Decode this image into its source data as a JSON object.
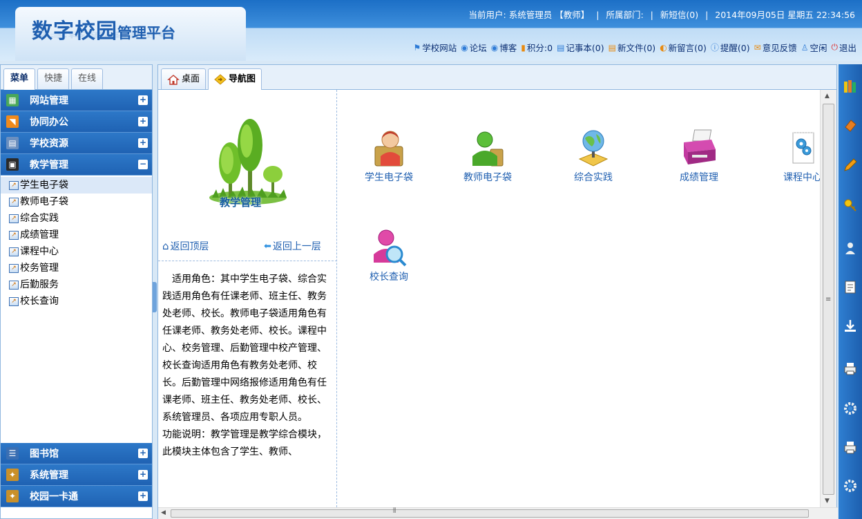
{
  "header": {
    "logo_main": "数字校园",
    "logo_small": "管理平台",
    "current_user_label": "当前用户:",
    "current_user": "系统管理员",
    "user_role": "【教师】",
    "department_label": "所属部门:",
    "sms": "新短信(0)",
    "date": "2014年09月05日 星期五",
    "time": "22:34:56"
  },
  "toolbar": [
    {
      "icon": "school-site-icon",
      "label": "学校网站"
    },
    {
      "icon": "forum-icon",
      "label": "论坛"
    },
    {
      "icon": "blog-icon",
      "label": "博客"
    },
    {
      "icon": "points-icon",
      "label": "积分:0"
    },
    {
      "icon": "notebook-icon",
      "label": "记事本(0)"
    },
    {
      "icon": "new-file-icon",
      "label": "新文件(0)"
    },
    {
      "icon": "new-message-icon",
      "label": "新留言(0)"
    },
    {
      "icon": "reminder-icon",
      "label": "提醒(0)"
    },
    {
      "icon": "feedback-icon",
      "label": "意见反馈"
    },
    {
      "icon": "idle-icon",
      "label": "空闲"
    },
    {
      "icon": "logout-icon",
      "label": "退出"
    }
  ],
  "left_tabs": [
    "菜单",
    "快捷",
    "在线"
  ],
  "menu": {
    "top": [
      {
        "label": "网站管理",
        "icon": "website-icon",
        "color": "#4aa85a"
      },
      {
        "label": "协同办公",
        "icon": "rss-icon",
        "color": "#f08a1c"
      },
      {
        "label": "学校资源",
        "icon": "resource-icon",
        "color": "#6b8fbf"
      },
      {
        "label": "教学管理",
        "icon": "teaching-icon",
        "color": "#2a2a2a"
      }
    ],
    "sub": [
      "学生电子袋",
      "教师电子袋",
      "综合实践",
      "成绩管理",
      "课程中心",
      "校务管理",
      "后勤服务",
      "校长查询"
    ],
    "bottom": [
      {
        "label": "图书馆",
        "icon": "library-icon"
      },
      {
        "label": "系统管理",
        "icon": "system-icon"
      },
      {
        "label": "校园一卡通",
        "icon": "card-icon"
      }
    ]
  },
  "main_tabs": [
    {
      "label": "桌面",
      "icon": "home-icon"
    },
    {
      "label": "导航图",
      "icon": "navigation-icon"
    }
  ],
  "nav": {
    "module": "教学管理",
    "back_top": "返回顶层",
    "back_up": "返回上一层",
    "desc1": "适用角色：其中学生电子袋、综合实践适用角色有任课老师、班主任、教务处老师、校长。教师电子袋适用角色有任课老师、教务处老师、校长。课程中心、校务管理、后勤管理中校产管理、校长查询适用角色有教务处老师、校长。后勤管理中网络报修适用角色有任课老师、班主任、教务处老师、校长、系统管理员、各项应用专职人员。",
    "desc2": "功能说明：教学管理是教学综合模块，此模块主体包含了学生、教师、"
  },
  "apps": [
    "学生电子袋",
    "教师电子袋",
    "综合实践",
    "成绩管理",
    "课程中心",
    "校长查询"
  ]
}
